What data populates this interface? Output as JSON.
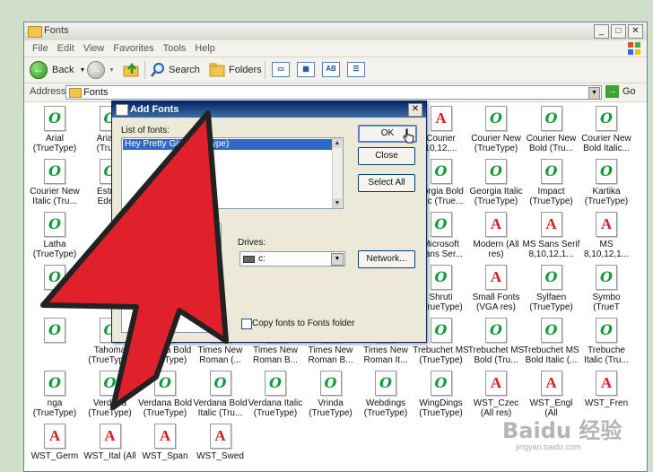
{
  "window": {
    "title": "Fonts"
  },
  "menu": [
    "File",
    "Edit",
    "View",
    "Favorites",
    "Tools",
    "Help"
  ],
  "toolbar": {
    "back": "Back",
    "search": "Search",
    "folders": "Folders"
  },
  "address": {
    "label": "Address",
    "value": "Fonts",
    "go": "Go"
  },
  "icons": [
    {
      "label": "Arial\n(TrueType)",
      "type": "o"
    },
    {
      "label": "Arial B\n(TrueT",
      "type": "o"
    },
    {
      "label": "",
      "type": "o"
    },
    {
      "label": "",
      "type": "o"
    },
    {
      "label": "",
      "type": "o"
    },
    {
      "label": "",
      "type": "o"
    },
    {
      "label": "",
      "type": "o"
    },
    {
      "label": "Courier\n10,12,...",
      "type": "a"
    },
    {
      "label": "Courier New\n(TrueType)",
      "type": "o"
    },
    {
      "label": "Courier New\nBold (Tru...",
      "type": "o"
    },
    {
      "label": "Courier New\nBold Italic...",
      "type": "o"
    },
    {
      "label": "Courier New\nItalic (Tru...",
      "type": "o"
    },
    {
      "label": "Estran\nEdess",
      "type": "o"
    },
    {
      "label": "",
      "type": "o"
    },
    {
      "label": "",
      "type": "o"
    },
    {
      "label": "",
      "type": "o"
    },
    {
      "label": "",
      "type": "o"
    },
    {
      "label": "",
      "type": "o"
    },
    {
      "label": "eorgia Bold\nalic (True...",
      "type": "o"
    },
    {
      "label": "Georgia Italic\n(TrueType)",
      "type": "o"
    },
    {
      "label": "Impact\n(TrueType)",
      "type": "o"
    },
    {
      "label": "Kartika\n(TrueType)",
      "type": "o"
    },
    {
      "label": "Latha\n(TrueType)",
      "type": "o"
    },
    {
      "label": "",
      "type": "o"
    },
    {
      "label": "",
      "type": "o"
    },
    {
      "label": "",
      "type": "o"
    },
    {
      "label": "",
      "type": "o"
    },
    {
      "label": "",
      "type": "o"
    },
    {
      "label": "Mangal\n(TrueType)",
      "type": "o"
    },
    {
      "label": "Microsoft\nSans Ser...",
      "type": "o"
    },
    {
      "label": "Modern (All\nres)",
      "type": "a"
    },
    {
      "label": "MS Sans Serif\n8,10,12,1...",
      "type": "a"
    },
    {
      "label": "MS\n8,10,12,1...",
      "type": "a"
    },
    {
      "label": "",
      "type": "o"
    },
    {
      "label": "",
      "type": "o"
    },
    {
      "label": "",
      "type": "o"
    },
    {
      "label": "",
      "type": "o"
    },
    {
      "label": "",
      "type": "o"
    },
    {
      "label": "oman (All\nres)",
      "type": "a"
    },
    {
      "label": "Script (All\nres)",
      "type": "a"
    },
    {
      "label": "Shruti\n(TrueType)",
      "type": "o"
    },
    {
      "label": "Small Fonts\n(VGA res)",
      "type": "a"
    },
    {
      "label": "Sylfaen\n(TrueType)",
      "type": "o"
    },
    {
      "label": "Symbo\n(TrueT",
      "type": "o"
    },
    {
      "label": "",
      "type": "o"
    },
    {
      "label": "Tahoma\n(TrueType)",
      "type": "o"
    },
    {
      "label": "Tahoma Bold\n(TrueType)",
      "type": "o"
    },
    {
      "label": "Times New\nRoman (...",
      "type": "o"
    },
    {
      "label": "Times New\nRoman B...",
      "type": "o"
    },
    {
      "label": "Times New\nRoman B...",
      "type": "o"
    },
    {
      "label": "Times New\nRoman It...",
      "type": "o"
    },
    {
      "label": "Trebuchet MS\n(TrueType)",
      "type": "o"
    },
    {
      "label": "Trebuchet MS\nBold (Tru...",
      "type": "o"
    },
    {
      "label": "Trebuchet MS\nBold Italic (...",
      "type": "o"
    },
    {
      "label": "Trebuche\nItalic (Tru...",
      "type": "o"
    },
    {
      "label": "nga\n(TrueType)",
      "type": "o"
    },
    {
      "label": "Verdana\n(TrueType)",
      "type": "o"
    },
    {
      "label": "Verdana Bold\n(TrueType)",
      "type": "o"
    },
    {
      "label": "Verdana Bold\nItalic (Tru...",
      "type": "o"
    },
    {
      "label": "Verdana Italic\n(TrueType)",
      "type": "o"
    },
    {
      "label": "Vrinda\n(TrueType)",
      "type": "o"
    },
    {
      "label": "Webdings\n(TrueType)",
      "type": "o"
    },
    {
      "label": "WingDings\n(TrueType)",
      "type": "o"
    },
    {
      "label": "WST_Czec\n(All res)",
      "type": "a"
    },
    {
      "label": "WST_Engl (All",
      "type": "a"
    },
    {
      "label": "WST_Fren",
      "type": "a"
    },
    {
      "label": "WST_Germ",
      "type": "a"
    },
    {
      "label": "WST_Ital (All",
      "type": "a"
    },
    {
      "label": "WST_Span",
      "type": "a"
    },
    {
      "label": "WST_Swed",
      "type": "a"
    }
  ],
  "dialog": {
    "title": "Add Fonts",
    "list_label": "List of fonts:",
    "selected_font": "Hey Pretty Girl (TrueType)",
    "ok": "OK",
    "close": "Close",
    "select_all": "Select All",
    "drives_label": "Drives:",
    "drive_value": "c:",
    "network": "Network...",
    "copy_label": "Copy fonts to Fonts folder"
  },
  "watermark": {
    "brand": "Baidu 经验",
    "url": "jingyan.baidu.com"
  },
  "colors": {
    "arrow": "#e0202a",
    "titlebar": "#0a246a",
    "selection": "#316ac5"
  }
}
